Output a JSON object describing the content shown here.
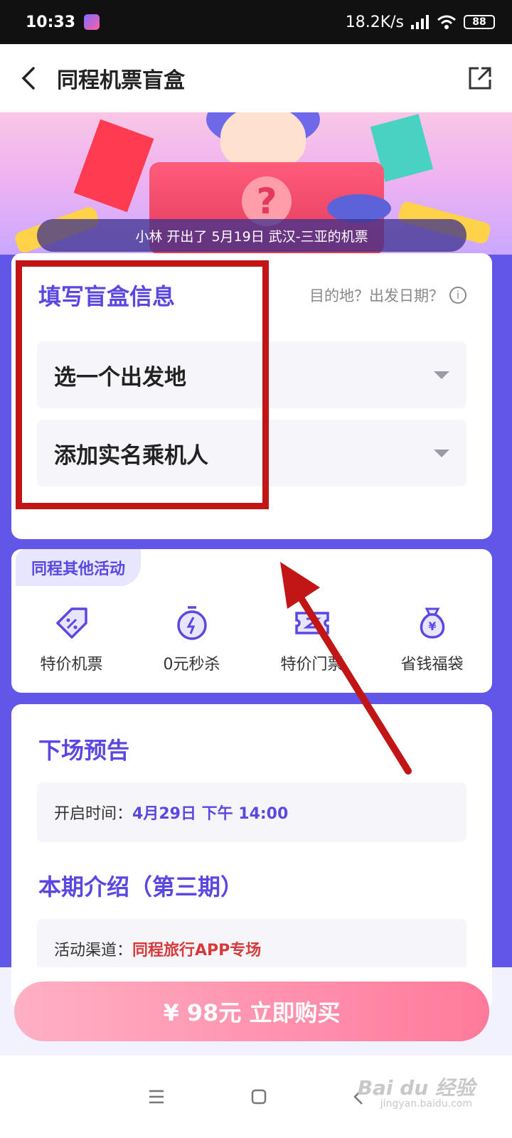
{
  "status_bar": {
    "time": "10:33",
    "network_speed": "18.2K/s",
    "battery": "88"
  },
  "header": {
    "title": "同程机票盲盒",
    "icons": [
      "back-arrow-icon",
      "share-icon"
    ]
  },
  "banner": {
    "ticker_text": "小林 开出了 5月19日 武汉-三亚的机票"
  },
  "form": {
    "title": "填写盲盒信息",
    "hint": "目的地？出发日期？",
    "departure_placeholder": "选一个出发地",
    "passenger_placeholder": "添加实名乘机人"
  },
  "activities": {
    "tag": "同程其他活动",
    "items": [
      {
        "label": "特价机票",
        "icon": "discount-tag-icon"
      },
      {
        "label": "0元秒杀",
        "icon": "stopwatch-icon"
      },
      {
        "label": "特价门票",
        "icon": "ticket-icon"
      },
      {
        "label": "省钱福袋",
        "icon": "money-bag-icon"
      }
    ]
  },
  "info": {
    "next_title": "下场预告",
    "open_time_label": "开启时间：",
    "open_time_value": "4月29日 下午 14:00",
    "intro_title": "本期介绍（第三期）",
    "channel_label": "活动渠道：",
    "channel_value": "同程旅行APP专场"
  },
  "buy": {
    "label": "¥ 98元 立即购买"
  },
  "watermark": {
    "text": "Bai du 经验",
    "sub": "jingyan.baidu.com"
  },
  "colors": {
    "accent": "#5a48e0",
    "annotation": "#c21515",
    "buy_button": "#ff7a9b"
  }
}
